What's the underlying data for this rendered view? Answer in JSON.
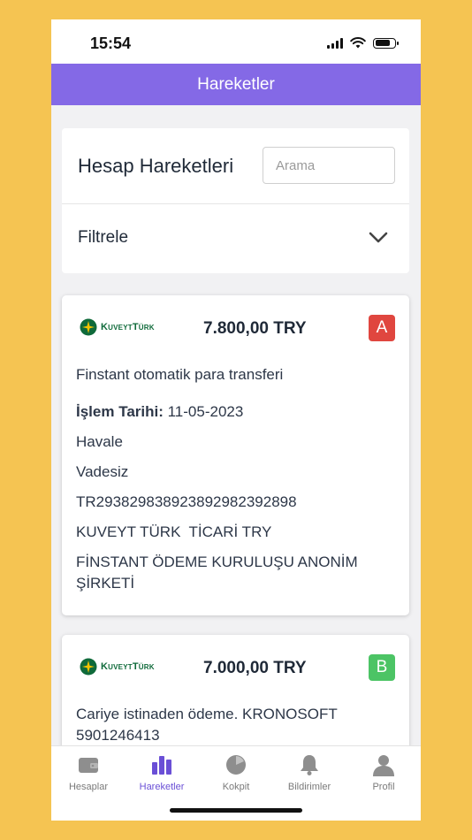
{
  "status": {
    "time": "15:54"
  },
  "nav": {
    "title": "Hareketler"
  },
  "header": {
    "title": "Hesap Hareketleri",
    "search_placeholder": "Arama",
    "filter_label": "Filtrele"
  },
  "transactions": [
    {
      "bank": "KuveytTürk",
      "amount": "7.800,00 TRY",
      "badge": "A",
      "badge_color": "#e0463f",
      "description": "Finstant otomatik para transferi",
      "date_label": "İşlem Tarihi:",
      "date_value": " 11-05-2023",
      "type": "Havale",
      "account_type": "Vadesiz",
      "iban": "TR293829838923892982392898",
      "account_name": "KUVEYT TÜRK  TİCARİ TRY",
      "counterparty": "FİNSTANT ÖDEME KURULUŞU ANONİM ŞİRKETİ"
    },
    {
      "bank": "KuveytTürk",
      "amount": "7.000,00 TRY",
      "badge": "B",
      "badge_color": "#4cc465",
      "description": "Cariye istinaden ödeme. KRONOSOFT 5901246413"
    }
  ],
  "tabs": [
    {
      "label": "Hesaplar",
      "icon": "wallet-icon"
    },
    {
      "label": "Hareketler",
      "icon": "bar-chart-icon",
      "active": true
    },
    {
      "label": "Kokpit",
      "icon": "pie-chart-icon"
    },
    {
      "label": "Bildirimler",
      "icon": "bell-icon"
    },
    {
      "label": "Profil",
      "icon": "user-icon"
    }
  ],
  "colors": {
    "accent": "#8469e6",
    "active_tab": "#6a4fd6",
    "background": "#f5c452"
  }
}
